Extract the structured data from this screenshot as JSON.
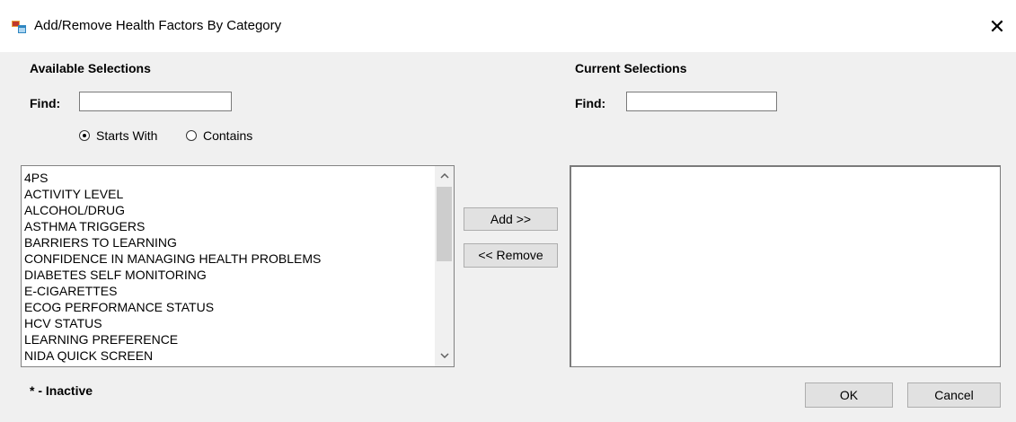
{
  "window": {
    "title": "Add/Remove Health Factors By Category",
    "close_symbol": "✕"
  },
  "available": {
    "heading": "Available Selections",
    "find_label": "Find:",
    "find_value": "",
    "starts_with_label": "Starts With",
    "contains_label": "Contains",
    "selected_match_mode": "Starts With",
    "items": [
      "4PS",
      "ACTIVITY LEVEL",
      "ALCOHOL/DRUG",
      "ASTHMA TRIGGERS",
      "BARRIERS TO LEARNING",
      "CONFIDENCE IN MANAGING HEALTH PROBLEMS",
      "DIABETES SELF MONITORING",
      "E-CIGARETTES",
      "ECOG PERFORMANCE STATUS",
      "HCV STATUS",
      "LEARNING PREFERENCE",
      "NIDA QUICK SCREEN"
    ]
  },
  "current": {
    "heading": "Current Selections",
    "find_label": "Find:",
    "find_value": "",
    "items": []
  },
  "buttons": {
    "add": "Add >>",
    "remove": "<< Remove",
    "ok": "OK",
    "cancel": "Cancel"
  },
  "footer": {
    "inactive_note": "* - Inactive"
  },
  "icons": {
    "scroll_up": "chevron-up-icon",
    "scroll_down": "chevron-down-icon",
    "app": "app-window-icon",
    "close": "close-icon"
  }
}
